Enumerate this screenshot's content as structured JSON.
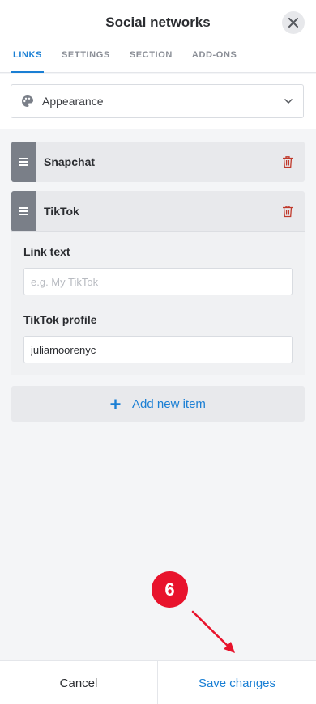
{
  "header": {
    "title": "Social networks",
    "close_icon": "close-icon"
  },
  "tabs": [
    {
      "label": "LINKS",
      "active": true
    },
    {
      "label": "SETTINGS",
      "active": false
    },
    {
      "label": "SECTION",
      "active": false
    },
    {
      "label": "ADD-ONS",
      "active": false
    }
  ],
  "appearance": {
    "label": "Appearance",
    "icon": "palette-icon"
  },
  "items": [
    {
      "name": "Snapchat",
      "expanded": false
    },
    {
      "name": "TikTok",
      "expanded": true,
      "fields": {
        "link_text_label": "Link text",
        "link_text_placeholder": "e.g. My TikTok",
        "link_text_value": "",
        "profile_label": "TikTok profile",
        "profile_value": "juliamoorenyc"
      }
    }
  ],
  "add_item": {
    "label": "Add new item"
  },
  "footer": {
    "cancel": "Cancel",
    "save": "Save changes"
  },
  "annotation": {
    "step": "6"
  },
  "colors": {
    "accent": "#1a7fd4",
    "badge": "#e8132c",
    "trash": "#c0392b",
    "handle": "#7a7f88"
  }
}
